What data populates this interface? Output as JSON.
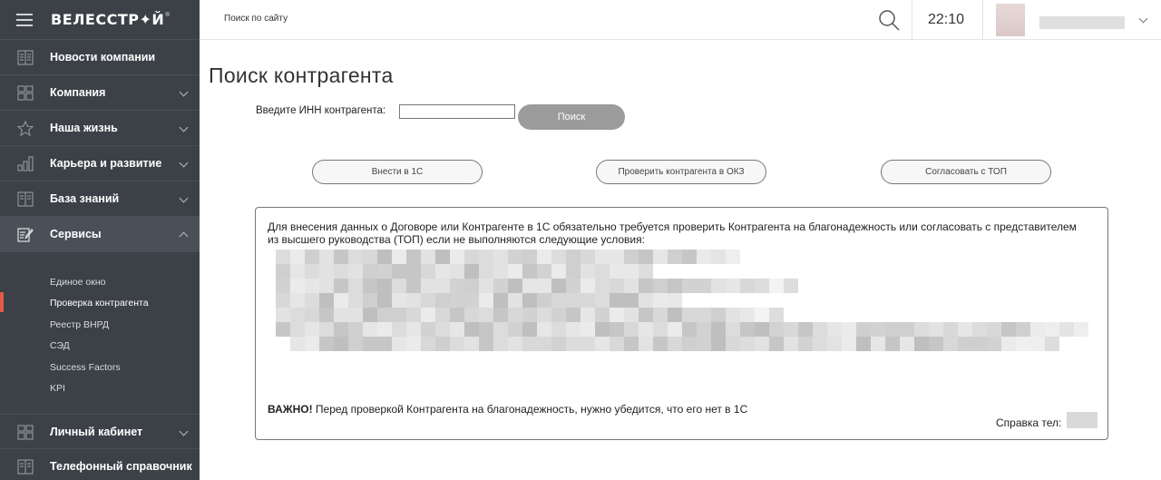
{
  "sidebar": {
    "logo": "ВЕЛЕССТР",
    "logo_mark": "Й",
    "items": [
      {
        "label": "Новости компании",
        "icon": "news-icon",
        "chevron": "none"
      },
      {
        "label": "Компания",
        "icon": "grid-icon",
        "chevron": "down"
      },
      {
        "label": "Наша жизнь",
        "icon": "star-icon",
        "chevron": "down"
      },
      {
        "label": "Карьера и развитие",
        "icon": "chart-icon",
        "chevron": "down"
      },
      {
        "label": "База знаний",
        "icon": "book-icon",
        "chevron": "down"
      },
      {
        "label": "Сервисы",
        "icon": "edit-icon",
        "chevron": "up"
      }
    ],
    "subitems": [
      {
        "label": "Единое окно"
      },
      {
        "label": "Проверка контрагента",
        "active": true
      },
      {
        "label": "Реестр ВНРД"
      },
      {
        "label": "СЭД"
      },
      {
        "label": "Success Factors"
      },
      {
        "label": "KPI"
      }
    ],
    "bottom_items": [
      {
        "label": "Личный кабинет",
        "icon": "grid-icon",
        "chevron": "down"
      },
      {
        "label": "Телефонный справочник",
        "icon": "book-icon",
        "chevron": "none"
      }
    ]
  },
  "topbar": {
    "search_placeholder": "Поиск по сайту",
    "time": "22:10"
  },
  "main": {
    "title": "Поиск контрагента",
    "inn_label": "Введите ИНН контрагента:",
    "inn_value": "",
    "search_button": "Поиск",
    "actions": [
      "Внести в 1С",
      "Проверить контрагента в ОКЗ",
      "Согласовать с ТОП"
    ],
    "info_text": "Для внесения данных о Договоре или Контрагенте в 1С обязательно требуется проверить Контрагента на благонадежность или согласовать с представителем из высшего руководства (ТОП) если не выполняются следующие условия:",
    "important_label": "ВАЖНО!",
    "important_text": " Перед проверкой Контрагента на благонадежность, нужно убедится, что его нет в 1С",
    "help_label": "Справка тел:"
  },
  "colors": {
    "sidebar_bg": "#3c4147",
    "active_marker": "#e35a4a",
    "search_button": "#9b9b9b"
  }
}
